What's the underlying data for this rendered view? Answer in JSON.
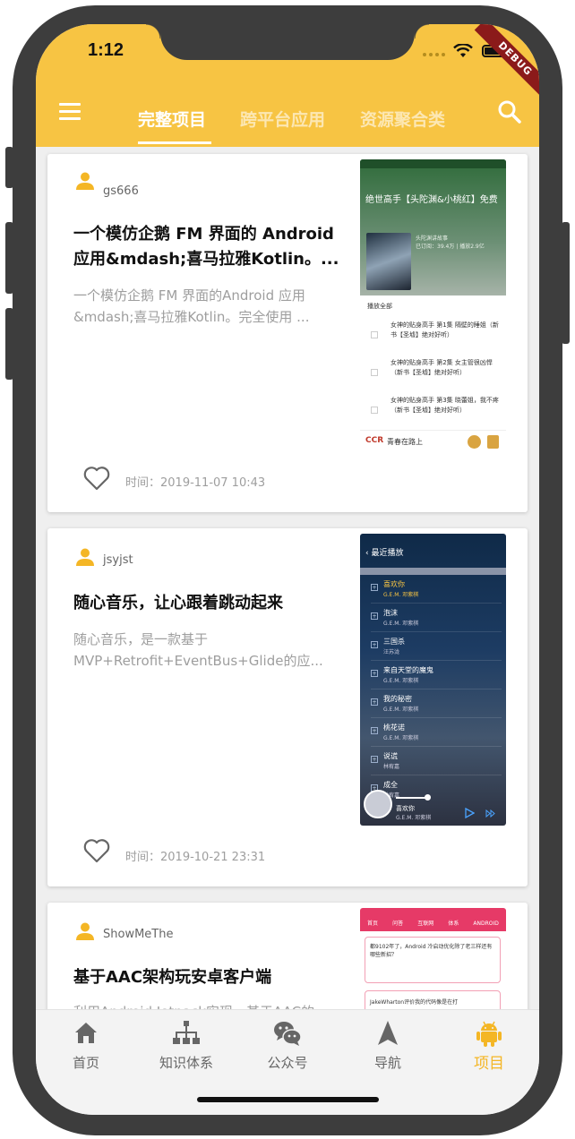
{
  "status_bar": {
    "time": "1:12",
    "debug_label": "DEBUG"
  },
  "colors": {
    "primary": "#f7c443",
    "accent": "#f4b625",
    "background": "#efefef"
  },
  "header": {
    "tabs": [
      {
        "label": "完整项目",
        "active": true
      },
      {
        "label": "跨平台应用",
        "active": false
      },
      {
        "label": "资源聚合类",
        "active": false
      }
    ],
    "menu_icon": "menu-icon",
    "search_icon": "search-icon"
  },
  "articles": [
    {
      "author": "gs666",
      "title": "一个模仿企鹅 FM 界面的 Android 应用&mdash;喜马拉雅Kotlin。...",
      "description": "一个模仿企鹅 FM 界面的Android 应用&mdash;喜马拉雅Kotlin。完全使用 ...",
      "time": "时间：2019-11-07 10:43",
      "thumbnail": {
        "header_title": "绝世高手【头陀渊&小桃红】免费",
        "meta_1": "头陀渊讲故事",
        "meta_2": "已订阅：39.4万 | 播放2.9亿",
        "play_all": "播放全部",
        "episodes": [
          "女神的贴身高手 第1集 隔壁的睡姐（新书【圣墟】绝对好听）",
          "女神的贴身高手 第2集 女主管很凶悍（新书【圣墟】绝对好听）",
          "女神的贴身高手 第3集 晓蕾姐，我不疼（新书【圣墟】绝对好听）"
        ],
        "footer_logo": "CCR",
        "footer_text": "青春在路上"
      }
    },
    {
      "author": "jsyjst",
      "title": "随心音乐，让心跟着跳动起来",
      "description": "随心音乐，是一款基于MVP+Retrofit+EventBus+Glide的应...",
      "time": "时间：2019-10-21 23:31",
      "thumbnail": {
        "header_title": "最近播放",
        "songs": [
          {
            "name": "喜欢你",
            "artist": "G.E.M. 邓紫棋"
          },
          {
            "name": "泡沫",
            "artist": "G.E.M. 邓紫棋"
          },
          {
            "name": "三国杀",
            "artist": "汪苏泷"
          },
          {
            "name": "来自天堂的魔鬼",
            "artist": "G.E.M. 邓紫棋"
          },
          {
            "name": "我的秘密",
            "artist": "G.E.M. 邓紫棋"
          },
          {
            "name": "桃花诺",
            "artist": "G.E.M. 邓紫棋"
          },
          {
            "name": "说谎",
            "artist": "林宥嘉"
          },
          {
            "name": "成全",
            "artist": "林宥嘉"
          }
        ],
        "now_playing_name": "喜欢你",
        "now_playing_artist": "G.E.M. 邓紫棋"
      }
    },
    {
      "author": "ShowMeThe",
      "title": "基于AAC架构玩安卓客户端",
      "description": "利用Android Jetpack实现，基于AAC的...",
      "time": "",
      "thumbnail": {
        "tabs": [
          "首页",
          "问答",
          "互联网",
          "体系",
          "ANDROID"
        ],
        "item_1": "都9102年了，Android 冷启动优化除了老三样还有哪些新招？",
        "item_2": "JakeWharton评价我的代码像是在打"
      }
    }
  ],
  "bottom_nav": [
    {
      "label": "首页",
      "icon": "home-icon",
      "active": false
    },
    {
      "label": "知识体系",
      "icon": "hierarchy-icon",
      "active": false
    },
    {
      "label": "公众号",
      "icon": "wechat-icon",
      "active": false
    },
    {
      "label": "导航",
      "icon": "navigation-icon",
      "active": false
    },
    {
      "label": "项目",
      "icon": "android-icon",
      "active": true
    }
  ]
}
